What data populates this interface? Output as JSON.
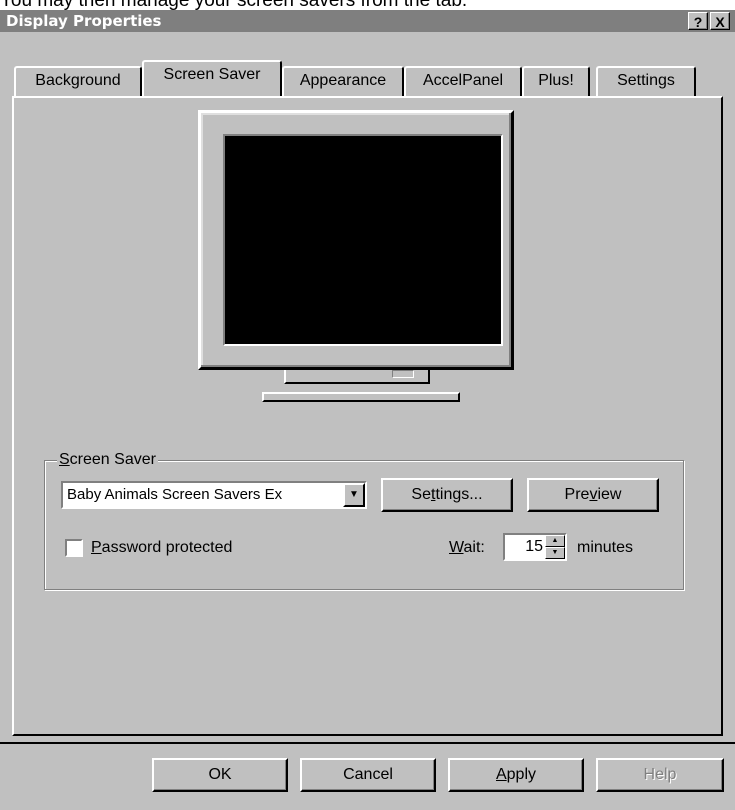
{
  "caption": "You may then manage your screen savers from the tab.",
  "window": {
    "title": "Display Properties",
    "help_label": "?",
    "close_label": "X"
  },
  "tabs": [
    {
      "label": "Background"
    },
    {
      "label": "Screen Saver",
      "active": true
    },
    {
      "label": "Appearance"
    },
    {
      "label": "AccelPanel"
    },
    {
      "label": "Plus!"
    },
    {
      "label": "Settings"
    }
  ],
  "screen_saver": {
    "group_label_mnemonic": "S",
    "group_label_rest": "creen Saver",
    "selected": "Baby Animals Screen Savers Ex",
    "settings_pre": "Se",
    "settings_mn": "t",
    "settings_post": "tings...",
    "preview_pre": "Pre",
    "preview_mn": "v",
    "preview_post": "iew",
    "password_mn": "P",
    "password_rest": "assword protected",
    "password_checked": false,
    "wait_mn": "W",
    "wait_rest": "ait:",
    "wait_value": "15",
    "minutes_label": "minutes"
  },
  "buttons": {
    "ok": "OK",
    "cancel": "Cancel",
    "apply_mn": "A",
    "apply_rest": "pply",
    "help": "Help"
  },
  "icons": {
    "combo_dropdown": "chevron-down-icon",
    "spin_up": "spin-up-icon",
    "spin_down": "spin-down-icon"
  }
}
